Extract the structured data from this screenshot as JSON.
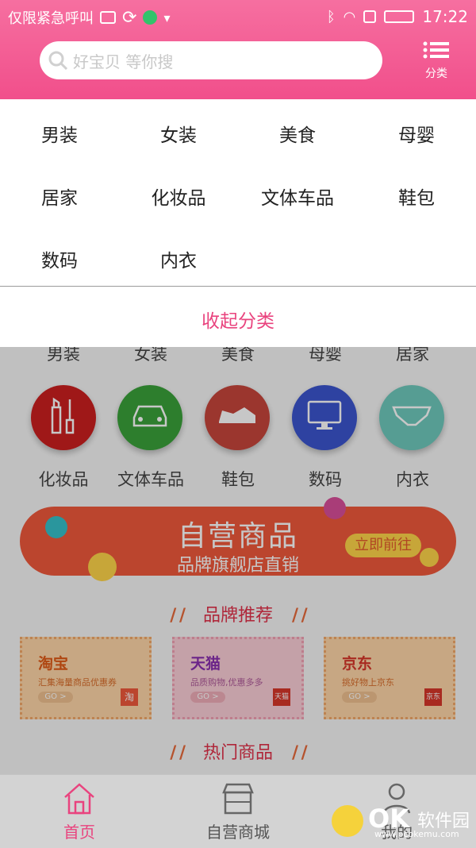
{
  "status_bar": {
    "carrier": "仅限紧急呼叫",
    "time": "17:22"
  },
  "search": {
    "placeholder": "好宝贝 等你搜"
  },
  "category_button": {
    "label": "分类"
  },
  "dropdown": {
    "items": [
      "男装",
      "女装",
      "美食",
      "母婴",
      "居家",
      "化妆品",
      "文体车品",
      "鞋包",
      "数码",
      "内衣"
    ],
    "collapse_label": "收起分类"
  },
  "background_categories": {
    "top_row": [
      "男装",
      "女装",
      "美食",
      "母婴",
      "居家"
    ],
    "bottom_row": [
      "化妆品",
      "文体车品",
      "鞋包",
      "数码",
      "内衣"
    ],
    "colors": [
      "#cc1f1f",
      "#3aa23a",
      "#c7463c",
      "#3c55cf",
      "#6fc9bd"
    ],
    "icons": [
      "lipstick-icon",
      "car-icon",
      "shoe-icon",
      "monitor-icon",
      "underwear-icon"
    ]
  },
  "promo": {
    "title": "自营商品",
    "subtitle": "品牌旗舰店直销",
    "button": "立即前往"
  },
  "brand_section": {
    "title": "品牌推荐",
    "brands": [
      {
        "name": "淘宝",
        "desc": "汇集海量商品优惠券",
        "go": "GO >",
        "logo": "淘",
        "color": "#e05a17"
      },
      {
        "name": "天猫",
        "desc": "品质购物,优惠多多",
        "go": "GO >",
        "logo": "天猫",
        "color": "#8a2fb0"
      },
      {
        "name": "京东",
        "desc": "挑好物上京东",
        "go": "GO >",
        "logo": "京东",
        "color": "#d8362a"
      }
    ]
  },
  "hot_section": {
    "title": "热门商品"
  },
  "bottom_nav": {
    "tabs": [
      {
        "label": "首页",
        "icon": "home-icon",
        "active": true
      },
      {
        "label": "自营商城",
        "icon": "store-icon",
        "active": false
      },
      {
        "label": "我的",
        "icon": "user-icon",
        "active": false
      }
    ]
  },
  "watermark": {
    "brand": "OK",
    "name": "软件园",
    "url": "www.pcokemu.com"
  },
  "colors": {
    "accent": "#f14f8b",
    "collapse": "#e9437e",
    "section_title": "#e0314a",
    "promo": "#f0593c"
  }
}
